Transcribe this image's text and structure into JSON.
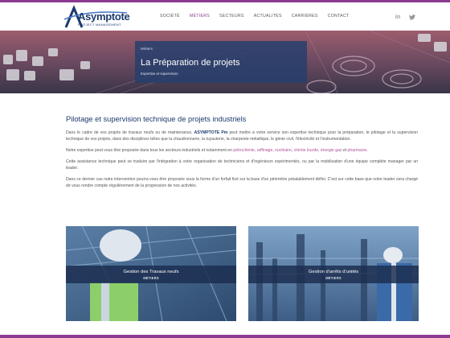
{
  "logo": {
    "name": "Asymptote",
    "sub": "PROJECT MANAGEMENT"
  },
  "nav": [
    {
      "label": "SOCIÉTÉ",
      "active": false
    },
    {
      "label": "MÉTIERS",
      "active": true
    },
    {
      "label": "SECTEURS",
      "active": false
    },
    {
      "label": "ACTUALITÉS",
      "active": false
    },
    {
      "label": "CARRIÈRES",
      "active": false
    },
    {
      "label": "CONTACT",
      "active": false
    }
  ],
  "social": {
    "linkedin": "in",
    "linkedin_icon": "linkedin-icon",
    "twitter_icon": "twitter-icon"
  },
  "hero": {
    "breadcrumb": "Métiers",
    "title": "La Préparation de projets",
    "subtitle": "Expertise et supervision"
  },
  "main": {
    "title": "Pilotage et supervision technique de projets industriels",
    "p1_a": "Dans le cadre de vos projets de travaux neufs ou de maintenance, ",
    "p1_brand": "ASYMPTOTE Pm",
    "p1_b": " peut mettre à votre service son expertise technique pour la préparation, le pilotage et la supervision technique de vos projets, dans des disciplines telles que la chaudronnerie, la tuyauterie, la charpente métallique, le génie civil, l'électricité et l'instrumentation.",
    "p2_a": "Notre expertise peut vous être proposée dans tous les secteurs industriels et notamment en ",
    "p2_links": [
      "pétrochimie",
      "raffinage",
      "nucléaire",
      "chimie lourde",
      "énergie gaz",
      "pharmacie"
    ],
    "p2_end": ".",
    "p3": "Cette assistance technique peut se traduire par l'intégration à votre organisation de techniciens et d'ingénieurs expérimentés, ou par la mobilisation d'une équipe complète manager par un leader.",
    "p4": "Dans ce dernier cas notre intervention pourra vous être proposée sous la forme d'un forfait fixé sur la base d'un périmètre préalablement défini. C'est sur cette base que notre leader sera chargé de vous rendre compte régulièrement de la progression de nos activités."
  },
  "cards": [
    {
      "title": "Gestion des Travaux neufs",
      "subtitle": "MÉTIERS"
    },
    {
      "title": "Gestion d'arrêts d'unités",
      "subtitle": "MÉTIERS"
    }
  ],
  "colors": {
    "accent": "#8c3a92",
    "brand": "#1c3a6e",
    "link": "#b2549b"
  }
}
